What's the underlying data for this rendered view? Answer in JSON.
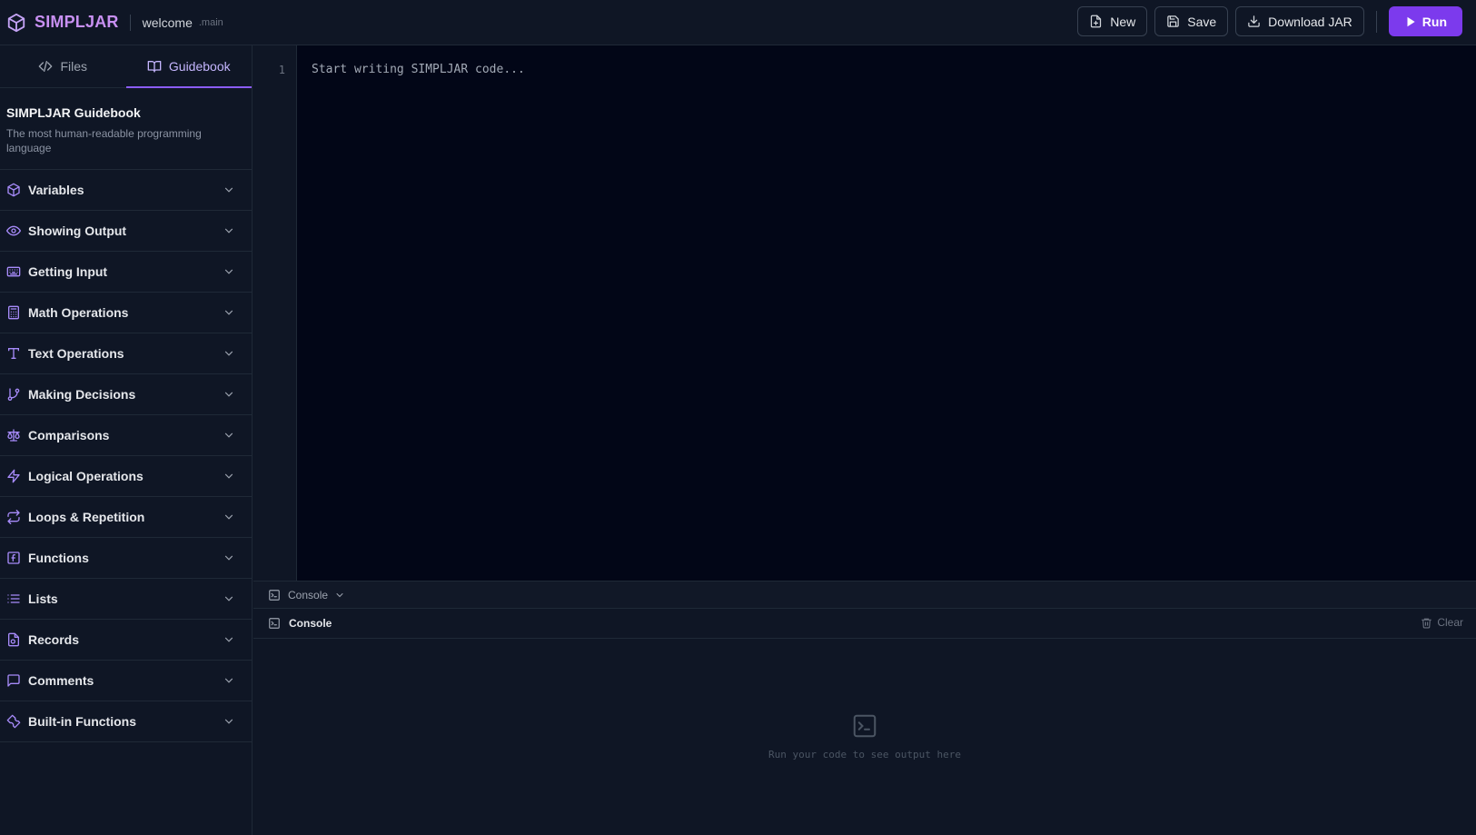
{
  "header": {
    "brand": "SIMPLJAR",
    "file_name": "welcome",
    "file_ext": ".main",
    "buttons": {
      "new": "New",
      "save": "Save",
      "download": "Download JAR",
      "run": "Run"
    }
  },
  "sidebar": {
    "tabs": [
      {
        "label": "Files",
        "icon": "code-icon"
      },
      {
        "label": "Guidebook",
        "icon": "book-icon",
        "active": true
      }
    ],
    "guidebook": {
      "title": "SIMPLJAR Guidebook",
      "subtitle": "The most human-readable programming language"
    },
    "items": [
      {
        "label": "Variables",
        "icon": "cube-icon"
      },
      {
        "label": "Showing Output",
        "icon": "eye-icon"
      },
      {
        "label": "Getting Input",
        "icon": "keyboard-icon"
      },
      {
        "label": "Math Operations",
        "icon": "calculator-icon"
      },
      {
        "label": "Text Operations",
        "icon": "type-icon"
      },
      {
        "label": "Making Decisions",
        "icon": "git-branch-icon"
      },
      {
        "label": "Comparisons",
        "icon": "scale-icon"
      },
      {
        "label": "Logical Operations",
        "icon": "zap-icon"
      },
      {
        "label": "Loops & Repetition",
        "icon": "repeat-icon"
      },
      {
        "label": "Functions",
        "icon": "function-icon"
      },
      {
        "label": "Lists",
        "icon": "list-icon"
      },
      {
        "label": "Records",
        "icon": "file-record-icon"
      },
      {
        "label": "Comments",
        "icon": "message-icon"
      },
      {
        "label": "Built-in Functions",
        "icon": "wrench-icon"
      }
    ]
  },
  "editor": {
    "line_number": "1",
    "placeholder": "Start writing SIMPLJAR code..."
  },
  "console_bar": {
    "label": "Console"
  },
  "console": {
    "title": "Console",
    "clear_label": "Clear",
    "empty_message": "Run your code to see output here"
  },
  "colors": {
    "accent": "#7c3aed",
    "brand": "#c890f2",
    "background": "#0f1625",
    "editor_background": "#020617"
  }
}
